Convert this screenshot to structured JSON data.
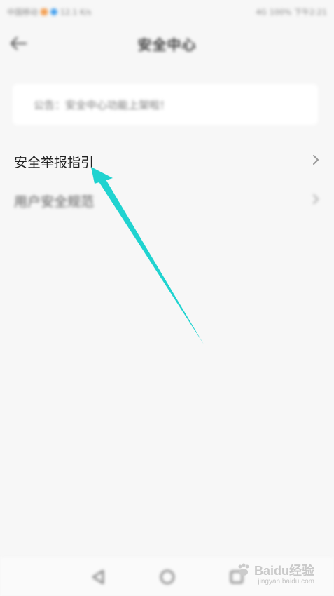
{
  "status_bar": {
    "carrier": "中国移动",
    "network_speed": "12.1 K/s",
    "signal": "4G",
    "battery": "100%",
    "time": "下午2:21",
    "colors": {
      "app_orange": "#f3a35a",
      "app_blue": "#4aa3ee"
    }
  },
  "header": {
    "title": "安全中心",
    "back_icon": "arrow-left-icon"
  },
  "notice": {
    "text": "公告：安全中心功能上架啦！"
  },
  "menu": {
    "items": [
      {
        "label": "安全举报指引",
        "icon": "chevron-right-icon"
      },
      {
        "label": "用户安全规范",
        "icon": "chevron-right-icon"
      }
    ]
  },
  "annotation": {
    "icon": "pointer-arrow-icon",
    "color": "#20d3d0"
  },
  "nav_bar": {
    "icons": [
      "back-triangle-icon",
      "home-circle-icon",
      "recent-square-icon"
    ]
  },
  "watermark": {
    "brand": "Baidu经验",
    "url": "jingyan.baidu.com"
  }
}
